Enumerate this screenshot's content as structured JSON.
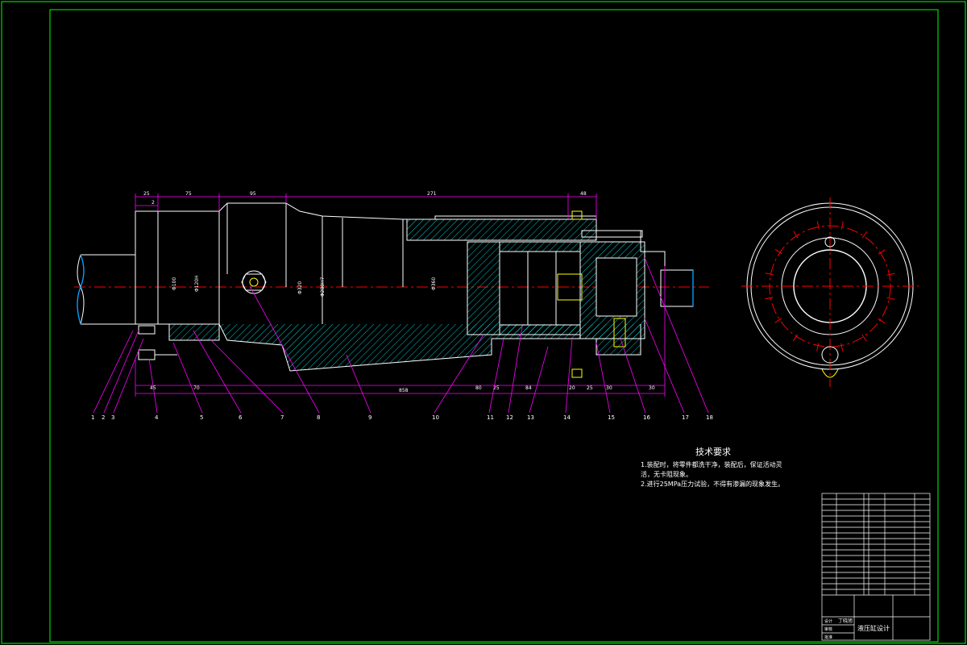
{
  "drawing": {
    "colors": {
      "background": "#000000",
      "frame": "#00ff00",
      "outline": "#ffffff",
      "centerline": "#ff0000",
      "dimension": "#ff00ff",
      "hatch": "#00ffff",
      "accent": "#ffff00"
    },
    "dimensions_top": [
      "25",
      "2",
      "75",
      "95",
      "271",
      "48"
    ],
    "dimensions_bottom": [
      "45",
      "70",
      "80",
      "25",
      "84",
      "20",
      "25",
      "30",
      "30"
    ],
    "overall_length": "858",
    "diameter_labels": [
      "Φ320",
      "Φ280H7"
    ],
    "balloons": [
      "1",
      "2",
      "3",
      "4",
      "5",
      "6",
      "7",
      "8",
      "9",
      "10",
      "11",
      "12",
      "13",
      "14",
      "15",
      "16",
      "17",
      "18"
    ]
  },
  "notes": {
    "title": "技术要求",
    "lines": [
      "1.装配时，将零件都洗干净，装配后，保证活动灵活，无卡阻现象。",
      "2.进行25MPa压力试验，不得有渗漏的现象发生。"
    ]
  },
  "title_block": {
    "drawing_name": "液压缸设计",
    "designer": "丁晓旭",
    "rows": [
      "设计",
      "审核",
      "批准"
    ]
  }
}
